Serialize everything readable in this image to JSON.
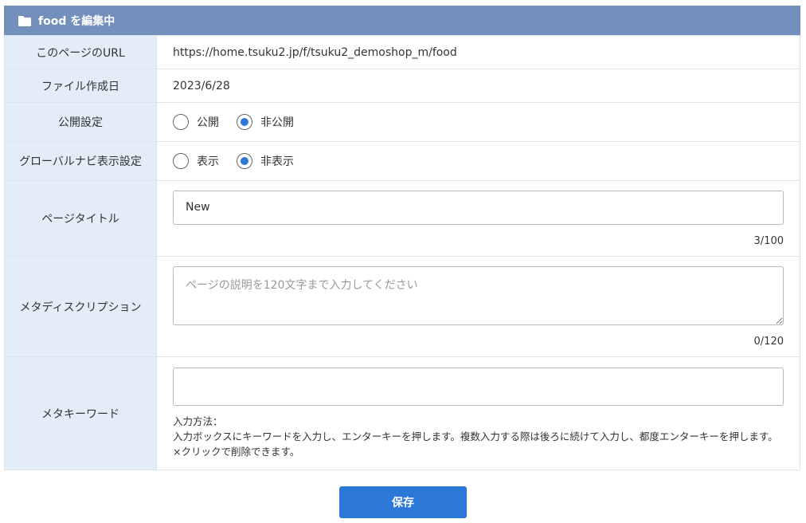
{
  "header": {
    "title": "food を編集中",
    "icon": "folder-icon",
    "bg_color": "#7390bd"
  },
  "rows": {
    "url": {
      "label": "このページのURL",
      "value": "https://home.tsuku2.jp/f/tsuku2_demoshop_m/food"
    },
    "created": {
      "label": "ファイル作成日",
      "value": "2023/6/28"
    },
    "publish": {
      "label": "公開設定",
      "options": [
        {
          "label": "公開",
          "selected": false
        },
        {
          "label": "非公開",
          "selected": true
        }
      ]
    },
    "gnav": {
      "label": "グローバルナビ表示設定",
      "options": [
        {
          "label": "表示",
          "selected": false
        },
        {
          "label": "非表示",
          "selected": true
        }
      ]
    },
    "title": {
      "label": "ページタイトル",
      "value": "New",
      "counter": "3/100"
    },
    "description": {
      "label": "メタディスクリプション",
      "value": "",
      "placeholder": "ページの説明を120文字まで入力してください",
      "counter": "0/120"
    },
    "keywords": {
      "label": "メタキーワード",
      "value": "",
      "help_title": "入力方法：",
      "help_text": "入力ボックスにキーワードを入力し、エンターキーを押します。複数入力する際は後ろに続けて入力し、都度エンターキーを押します。×クリックで削除できます。"
    }
  },
  "save_label": "保存",
  "accent_color": "#2b78d8"
}
